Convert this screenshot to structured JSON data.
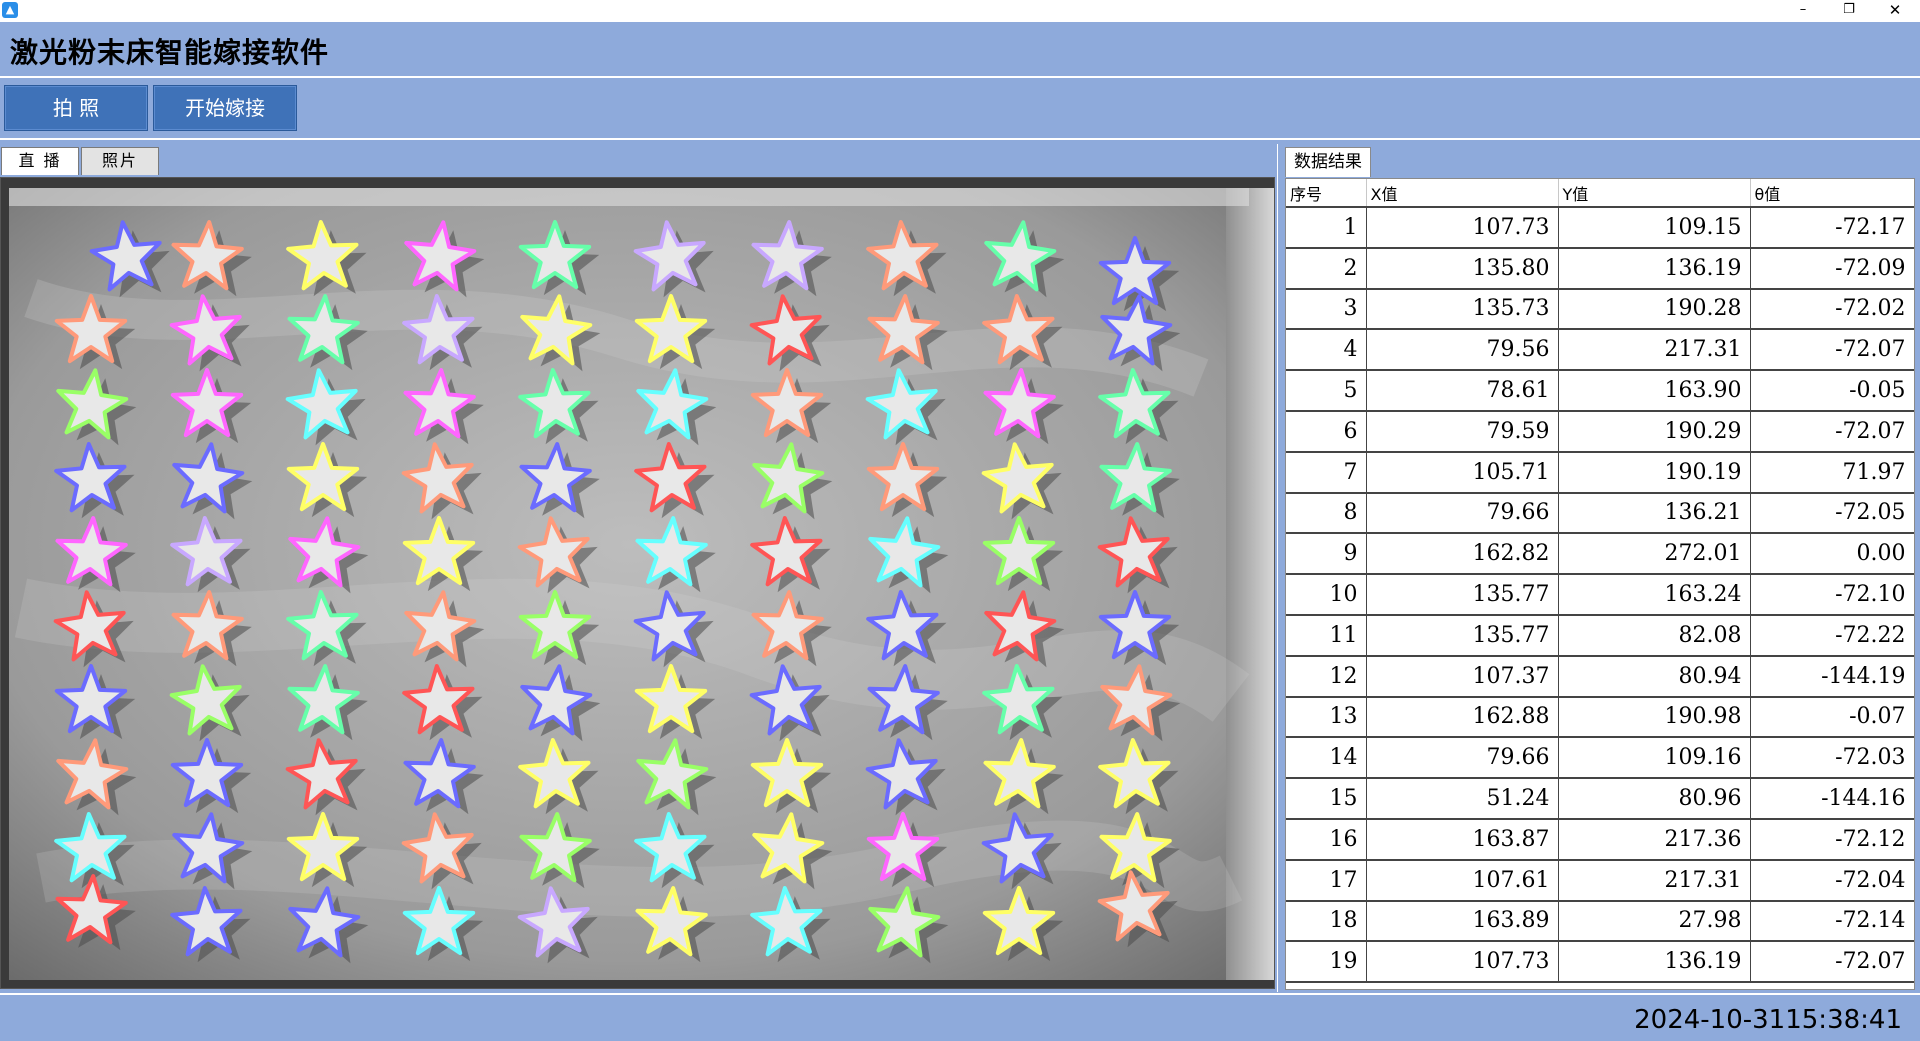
{
  "window": {
    "icon": "app-icon",
    "minimize": "–",
    "restore": "❐",
    "close": "✕"
  },
  "header": {
    "title": "激光粉末床智能嫁接软件"
  },
  "toolbar": {
    "photo_label": "拍 照",
    "start_label": "开始嫁接"
  },
  "view_tabs": {
    "live": "直 播",
    "photo": "照片"
  },
  "results": {
    "tab_label": "数据结果",
    "columns": [
      "序号",
      "X值",
      "Y值",
      "θ值"
    ],
    "rows": [
      [
        "1",
        "107.73",
        "109.15",
        "-72.17"
      ],
      [
        "2",
        "135.80",
        "136.19",
        "-72.09"
      ],
      [
        "3",
        "135.73",
        "190.28",
        "-72.02"
      ],
      [
        "4",
        "79.56",
        "217.31",
        "-72.07"
      ],
      [
        "5",
        "78.61",
        "163.90",
        "-0.05"
      ],
      [
        "6",
        "79.59",
        "190.29",
        "-72.07"
      ],
      [
        "7",
        "105.71",
        "190.19",
        "71.97"
      ],
      [
        "8",
        "79.66",
        "136.21",
        "-72.05"
      ],
      [
        "9",
        "162.82",
        "272.01",
        "0.00"
      ],
      [
        "10",
        "135.77",
        "163.24",
        "-72.10"
      ],
      [
        "11",
        "135.77",
        "82.08",
        "-72.22"
      ],
      [
        "12",
        "107.37",
        "80.94",
        "-144.19"
      ],
      [
        "13",
        "162.88",
        "190.98",
        "-0.07"
      ],
      [
        "14",
        "79.66",
        "109.16",
        "-72.03"
      ],
      [
        "15",
        "51.24",
        "80.96",
        "-144.16"
      ],
      [
        "16",
        "163.87",
        "217.36",
        "-72.12"
      ],
      [
        "17",
        "107.61",
        "217.31",
        "-72.04"
      ],
      [
        "18",
        "163.89",
        "27.98",
        "-72.14"
      ],
      [
        "19",
        "107.73",
        "136.19",
        "-72.07"
      ]
    ]
  },
  "stars": {
    "palette": [
      "#6b6bff",
      "#ff9a7a",
      "#ffff66",
      "#ff66ff",
      "#66ffaa",
      "#c8a8ff",
      "#ff5555",
      "#66ffff",
      "#99ff66",
      "#ffffff"
    ],
    "colors": [
      [
        0,
        1,
        2,
        3,
        4,
        5,
        5,
        1,
        4,
        0
      ],
      [
        1,
        3,
        4,
        5,
        2,
        2,
        6,
        1,
        1,
        0
      ],
      [
        8,
        3,
        7,
        3,
        4,
        7,
        1,
        7,
        3,
        4
      ],
      [
        0,
        0,
        2,
        1,
        0,
        6,
        8,
        1,
        2,
        4
      ],
      [
        3,
        5,
        3,
        2,
        1,
        7,
        6,
        7,
        8,
        6
      ],
      [
        6,
        1,
        4,
        1,
        8,
        0,
        1,
        0,
        6,
        0
      ],
      [
        0,
        8,
        4,
        6,
        0,
        2,
        0,
        0,
        4,
        1
      ],
      [
        1,
        0,
        6,
        0,
        2,
        8,
        2,
        0,
        2,
        2
      ],
      [
        7,
        0,
        2,
        1,
        8,
        7,
        2,
        3,
        0,
        2
      ],
      [
        6,
        0,
        0,
        7,
        5,
        2,
        7,
        8,
        2,
        1
      ]
    ]
  },
  "status": {
    "datetime": "2024-10-3115:38:41"
  }
}
